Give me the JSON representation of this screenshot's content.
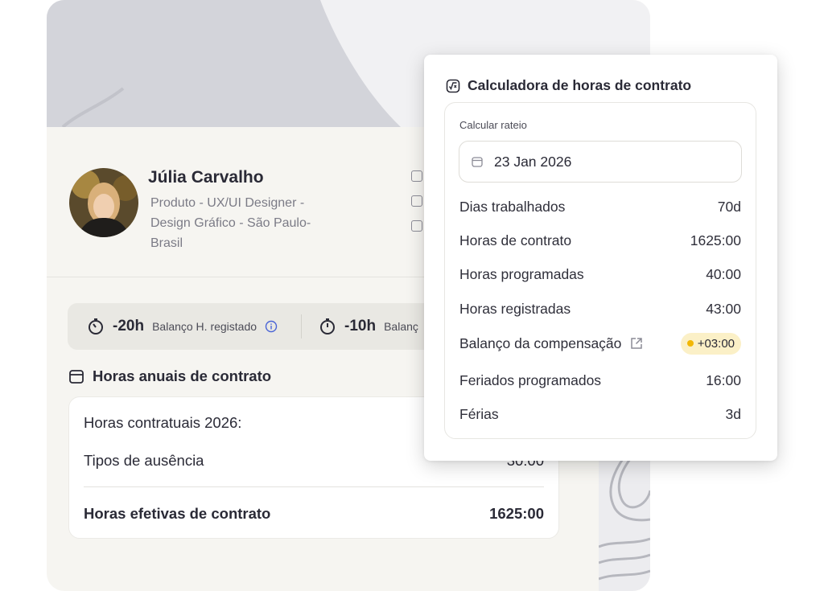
{
  "profile": {
    "name": "Júlia Carvalho",
    "role_lines": [
      "Produto - UX/UI Designer -",
      "Design Gráfico - São Paulo-",
      "Brasil"
    ]
  },
  "balances": [
    {
      "value": "-20h",
      "label": "Balanço H. registado",
      "icon": "stopwatch-icon"
    },
    {
      "value": "-10h",
      "label": "Balanç",
      "icon": "timer-icon"
    }
  ],
  "annual": {
    "title": "Horas anuais de contrato",
    "rows": [
      {
        "label": "Horas contratuais 2026:",
        "value": ""
      },
      {
        "label": "Tipos de ausência",
        "value": "30:00"
      }
    ],
    "total": {
      "label": "Horas efetivas de contrato",
      "value": "1625:00"
    }
  },
  "calculator": {
    "title": "Calculadora de horas de contrato",
    "section_label": "Calcular rateio",
    "date_value": "23 Jan 2026",
    "stats": [
      {
        "label": "Dias trabalhados",
        "value": "70d"
      },
      {
        "label": "Horas de contrato",
        "value": "1625:00"
      },
      {
        "label": "Horas programadas",
        "value": "40:00"
      },
      {
        "label": "Horas registradas",
        "value": "43:00"
      },
      {
        "label": "Balanço da compensação",
        "value": "+03:00",
        "badge": true
      },
      {
        "label": "Feriados programados",
        "value": "16:00"
      },
      {
        "label": "Férias",
        "value": "3d"
      }
    ]
  },
  "colors": {
    "accent_badge_bg": "#fbf0c7",
    "accent_dot": "#f2b705",
    "info_icon": "#4a64d6"
  }
}
